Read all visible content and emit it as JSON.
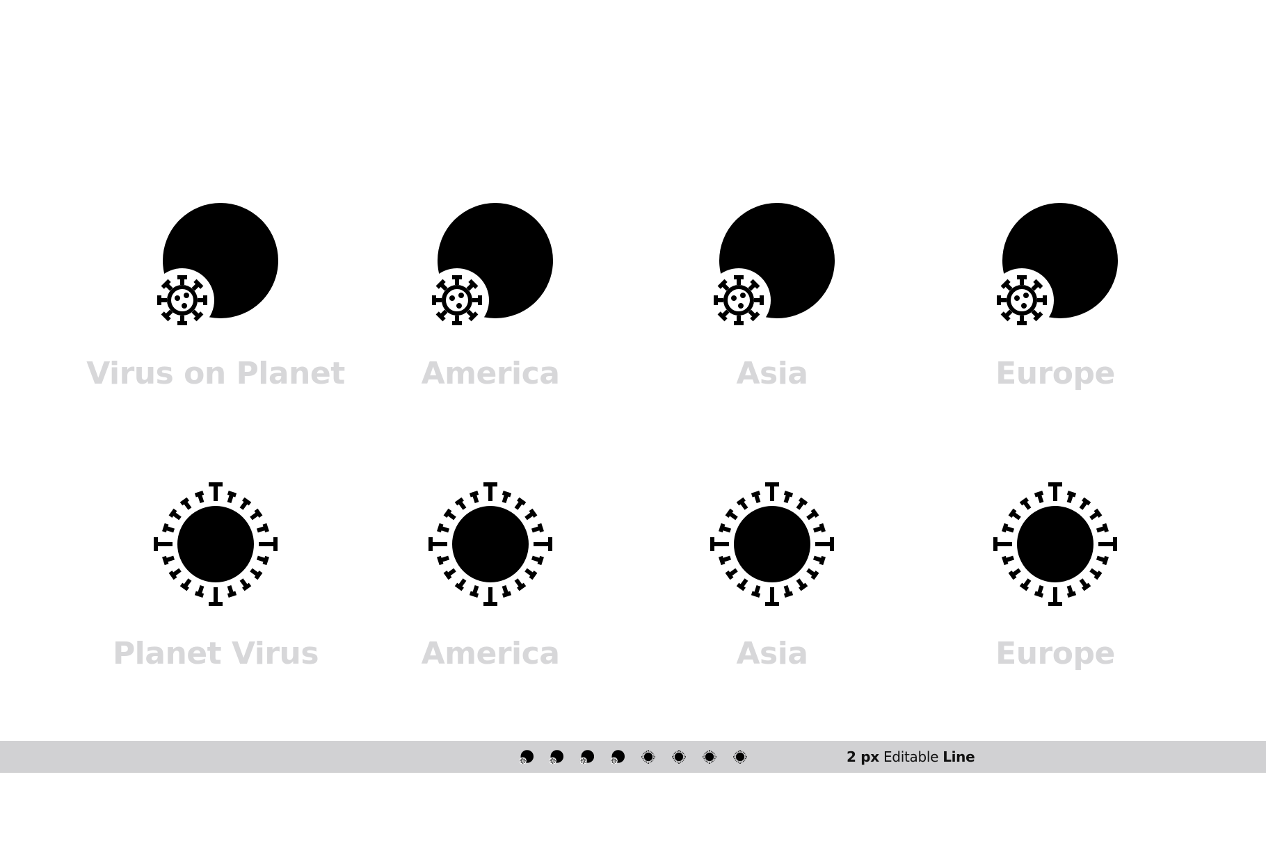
{
  "icons": [
    {
      "label": "Virus on Planet",
      "globe": "grid",
      "style": "corner-virus"
    },
    {
      "label": "America",
      "globe": "america",
      "style": "corner-virus"
    },
    {
      "label": "Asia",
      "globe": "asia",
      "style": "corner-virus"
    },
    {
      "label": "Europe",
      "globe": "europe",
      "style": "corner-virus"
    },
    {
      "label": "Planet Virus",
      "globe": "grid",
      "style": "spiked-ring"
    },
    {
      "label": "America",
      "globe": "america",
      "style": "spiked-ring"
    },
    {
      "label": "Asia",
      "globe": "asia",
      "style": "spiked-ring"
    },
    {
      "label": "Europe",
      "globe": "europe",
      "style": "spiked-ring"
    }
  ],
  "footer": {
    "stroke": "2 px",
    "middle": "Editable",
    "last": "Line"
  },
  "colors": {
    "background": "#ffffff",
    "label": "#d7d7d9",
    "bar": "#d1d1d3",
    "stroke": "#000000"
  }
}
